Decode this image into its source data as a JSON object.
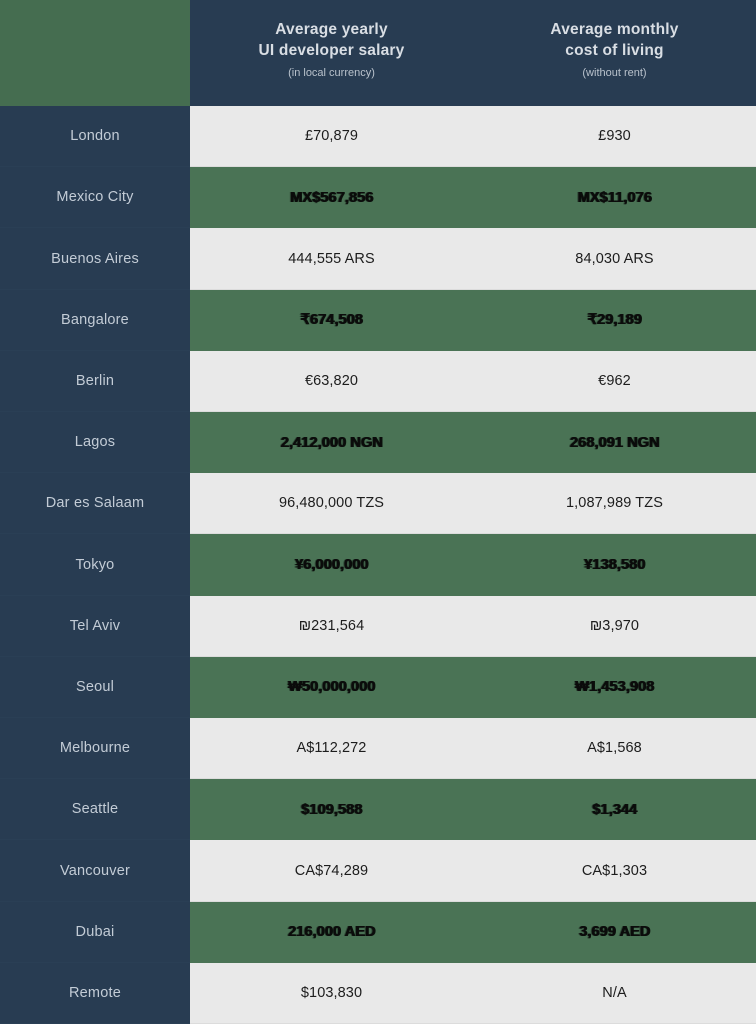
{
  "header": {
    "corner_label": "",
    "columns": [
      {
        "title_line1": "Average yearly",
        "title_line2": "UI developer salary",
        "subtitle": "(in local currency)"
      },
      {
        "title_line1": "Average monthly",
        "title_line2": "cost of living",
        "subtitle": "(without rent)"
      }
    ]
  },
  "colors": {
    "sidebar_navy": "#283c52",
    "header_navy": "#283c52",
    "corner_green": "#456d50",
    "row_green": "#4a7355",
    "row_light": "#e9e9e9",
    "page_background": "#2a3f55",
    "city_text": "#c3ccd6",
    "header_text": "#d9dee4"
  },
  "rows": [
    {
      "city": "London",
      "salary": "£70,879",
      "cost": "£930",
      "style": "light"
    },
    {
      "city": "Mexico City",
      "salary": "MX$567,856",
      "cost": "MX$11,076",
      "style": "green"
    },
    {
      "city": "Buenos Aires",
      "salary": "444,555 ARS",
      "cost": "84,030 ARS",
      "style": "light"
    },
    {
      "city": "Bangalore",
      "salary": "₹674,508",
      "cost": "₹29,189",
      "style": "green"
    },
    {
      "city": "Berlin",
      "salary": "€63,820",
      "cost": "€962",
      "style": "light"
    },
    {
      "city": "Lagos",
      "salary": "2,412,000 NGN",
      "cost": "268,091 NGN",
      "style": "green"
    },
    {
      "city": "Dar es Salaam",
      "salary": "96,480,000 TZS",
      "cost": "1,087,989 TZS",
      "style": "light"
    },
    {
      "city": "Tokyo",
      "salary": "¥6,000,000",
      "cost": "¥138,580",
      "style": "green"
    },
    {
      "city": "Tel Aviv",
      "salary": "₪231,564",
      "cost": "₪3,970",
      "style": "light"
    },
    {
      "city": "Seoul",
      "salary": "₩50,000,000",
      "cost": "₩1,453,908",
      "style": "green"
    },
    {
      "city": "Melbourne",
      "salary": "A$112,272",
      "cost": "A$1,568",
      "style": "light"
    },
    {
      "city": "Seattle",
      "salary": "$109,588",
      "cost": "$1,344",
      "style": "green"
    },
    {
      "city": "Vancouver",
      "salary": "CA$74,289",
      "cost": "CA$1,303",
      "style": "light"
    },
    {
      "city": "Dubai",
      "salary": "216,000 AED",
      "cost": "3,699 AED",
      "style": "green"
    },
    {
      "city": "Remote",
      "salary": "$103,830",
      "cost": "N/A",
      "style": "light"
    }
  ]
}
